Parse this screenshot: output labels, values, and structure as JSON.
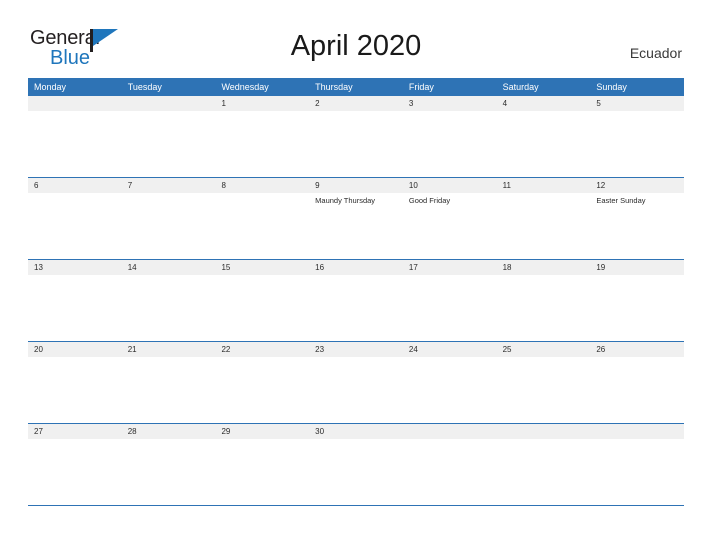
{
  "brand": {
    "name_part1": "General",
    "name_part2": "Blue",
    "logo_icon": "flag-icon",
    "color_blue": "#1f76bc",
    "color_dark": "#231f20"
  },
  "header": {
    "title": "April 2020",
    "country": "Ecuador"
  },
  "theme": {
    "header_blue": "#2e73b5",
    "band_gray": "#f0f0f0",
    "text_dark": "#2b2b2b",
    "page_background": "#ffffff"
  },
  "calendar": {
    "month": "April",
    "year": "2020",
    "weekday_headers": [
      "Monday",
      "Tuesday",
      "Wednesday",
      "Thursday",
      "Friday",
      "Saturday",
      "Sunday"
    ],
    "weeks": [
      {
        "days": [
          {
            "date": "",
            "event": ""
          },
          {
            "date": "",
            "event": ""
          },
          {
            "date": "1",
            "event": ""
          },
          {
            "date": "2",
            "event": ""
          },
          {
            "date": "3",
            "event": ""
          },
          {
            "date": "4",
            "event": ""
          },
          {
            "date": "5",
            "event": ""
          }
        ]
      },
      {
        "days": [
          {
            "date": "6",
            "event": ""
          },
          {
            "date": "7",
            "event": ""
          },
          {
            "date": "8",
            "event": ""
          },
          {
            "date": "9",
            "event": "Maundy Thursday"
          },
          {
            "date": "10",
            "event": "Good Friday"
          },
          {
            "date": "11",
            "event": ""
          },
          {
            "date": "12",
            "event": "Easter Sunday"
          }
        ]
      },
      {
        "days": [
          {
            "date": "13",
            "event": ""
          },
          {
            "date": "14",
            "event": ""
          },
          {
            "date": "15",
            "event": ""
          },
          {
            "date": "16",
            "event": ""
          },
          {
            "date": "17",
            "event": ""
          },
          {
            "date": "18",
            "event": ""
          },
          {
            "date": "19",
            "event": ""
          }
        ]
      },
      {
        "days": [
          {
            "date": "20",
            "event": ""
          },
          {
            "date": "21",
            "event": ""
          },
          {
            "date": "22",
            "event": ""
          },
          {
            "date": "23",
            "event": ""
          },
          {
            "date": "24",
            "event": ""
          },
          {
            "date": "25",
            "event": ""
          },
          {
            "date": "26",
            "event": ""
          }
        ]
      },
      {
        "days": [
          {
            "date": "27",
            "event": ""
          },
          {
            "date": "28",
            "event": ""
          },
          {
            "date": "29",
            "event": ""
          },
          {
            "date": "30",
            "event": ""
          },
          {
            "date": "",
            "event": ""
          },
          {
            "date": "",
            "event": ""
          },
          {
            "date": "",
            "event": ""
          }
        ]
      }
    ]
  }
}
